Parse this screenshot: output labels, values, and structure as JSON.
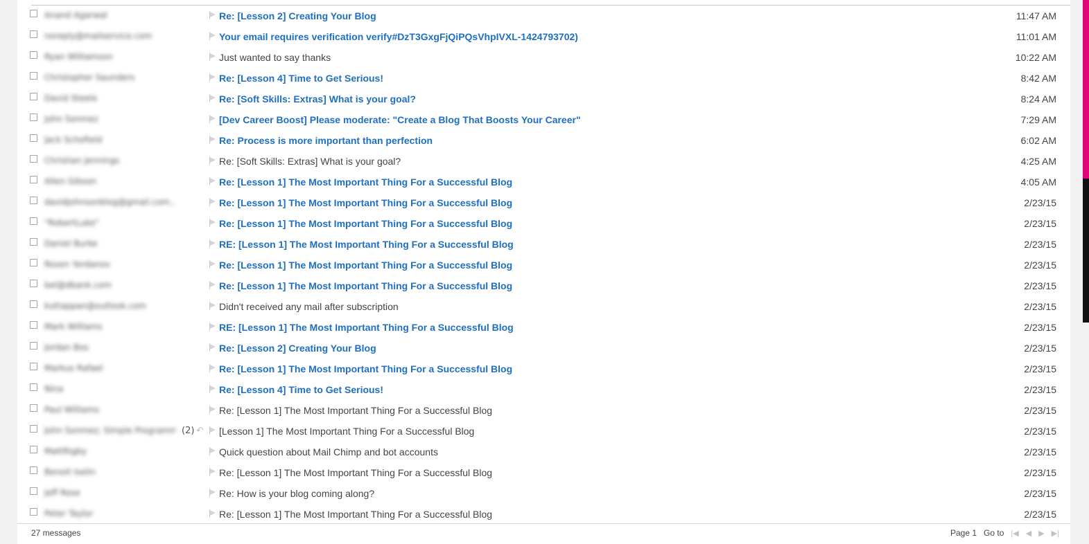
{
  "messages": [
    {
      "sender": "Anand Agarwal",
      "count": "",
      "subject": "Re: [Lesson 2] Creating Your Blog",
      "time": "11:47 AM",
      "unread": true
    },
    {
      "sender": "noreply@mailservice.com",
      "count": "",
      "subject": "Your email requires verification verify#DzT3GxgFjQiPQsVhpIVXL-1424793702)",
      "time": "11:01 AM",
      "unread": true
    },
    {
      "sender": "Ryan Williamson",
      "count": "",
      "subject": "Just wanted to say thanks",
      "time": "10:22 AM",
      "unread": false
    },
    {
      "sender": "Christopher Saunders",
      "count": "",
      "subject": "Re: [Lesson 4] Time to Get Serious!",
      "time": "8:42 AM",
      "unread": true
    },
    {
      "sender": "David Steele",
      "count": "",
      "subject": "Re: [Soft Skills: Extras] What is your goal?",
      "time": "8:24 AM",
      "unread": true
    },
    {
      "sender": "John Sonmez",
      "count": "",
      "subject": "[Dev Career Boost] Please moderate: \"Create a Blog That Boosts Your Career\"",
      "time": "7:29 AM",
      "unread": true
    },
    {
      "sender": "Jack Schofield",
      "count": "",
      "subject": "Re: Process is more important than perfection",
      "time": "6:02 AM",
      "unread": true
    },
    {
      "sender": "Christian Jennings",
      "count": "",
      "subject": "Re: [Soft Skills: Extras] What is your goal?",
      "time": "4:25 AM",
      "unread": false
    },
    {
      "sender": "Allen Gibson",
      "count": "",
      "subject": "Re: [Lesson 1] The Most Important Thing For a Successful Blog",
      "time": "4:05 AM",
      "unread": true
    },
    {
      "sender": "davidjohnsonblog@gmail.com...",
      "count": "",
      "subject": "Re: [Lesson 1] The Most Important Thing For a Successful Blog",
      "time": "2/23/15",
      "unread": true
    },
    {
      "sender": "\"RobertLuke\"",
      "count": "",
      "subject": "Re: [Lesson 1] The Most Important Thing For a Successful Blog",
      "time": "2/23/15",
      "unread": true
    },
    {
      "sender": "Daniel Burke",
      "count": "",
      "subject": "RE: [Lesson 1] The Most Important Thing For a Successful Blog",
      "time": "2/23/15",
      "unread": true
    },
    {
      "sender": "Rosen Yordanov",
      "count": "",
      "subject": "Re: [Lesson 1] The Most Important Thing For a Successful Blog",
      "time": "2/23/15",
      "unread": true
    },
    {
      "sender": "bel@dbank.com",
      "count": "",
      "subject": "Re: [Lesson 1] The Most Important Thing For a Successful Blog",
      "time": "2/23/15",
      "unread": true
    },
    {
      "sender": "kuttappan@outlook.com",
      "count": "",
      "subject": "Didn't received any mail after subscription",
      "time": "2/23/15",
      "unread": false
    },
    {
      "sender": "Mark Williams",
      "count": "",
      "subject": "RE: [Lesson 1] The Most Important Thing For a Successful Blog",
      "time": "2/23/15",
      "unread": true
    },
    {
      "sender": "Jordan Bos",
      "count": "",
      "subject": "Re: [Lesson 2] Creating Your Blog",
      "time": "2/23/15",
      "unread": true
    },
    {
      "sender": "Markus Rafael",
      "count": "",
      "subject": "Re: [Lesson 1] The Most Important Thing For a Successful Blog",
      "time": "2/23/15",
      "unread": true
    },
    {
      "sender": "Nina",
      "count": "",
      "subject": "Re: [Lesson 4] Time to Get Serious!",
      "time": "2/23/15",
      "unread": true
    },
    {
      "sender": "Paul Williams",
      "count": "",
      "subject": "Re: [Lesson 1] The Most Important Thing For a Successful Blog",
      "time": "2/23/15",
      "unread": false
    },
    {
      "sender": "John Sonmez; Simple Programmer...",
      "count": "(2)",
      "subject": "[Lesson 1] The Most Important Thing For a Successful Blog",
      "time": "2/23/15",
      "unread": false
    },
    {
      "sender": "MattRigby",
      "count": "",
      "subject": "Quick question about Mail Chimp and bot accounts",
      "time": "2/23/15",
      "unread": false
    },
    {
      "sender": "Benoit Iselin",
      "count": "",
      "subject": "Re: [Lesson 1] The Most Important Thing For a Successful Blog",
      "time": "2/23/15",
      "unread": false
    },
    {
      "sender": "Jeff Rose",
      "count": "",
      "subject": "Re: How is your blog coming along?",
      "time": "2/23/15",
      "unread": false
    },
    {
      "sender": "Peter Taylor",
      "count": "",
      "subject": "Re: [Lesson 1] The Most Important Thing For a Successful Blog",
      "time": "2/23/15",
      "unread": false
    }
  ],
  "footer": {
    "message_count": "27 messages",
    "page_label": "Page 1",
    "goto_label": "Go to"
  },
  "icons": {
    "flag": "flag-icon",
    "reply": "reply-icon",
    "first_page": "first-page-icon",
    "prev_page": "prev-page-icon",
    "next_page": "next-page-icon",
    "last_page": "last-page-icon"
  },
  "colors": {
    "unread_subject": "#1f6fc0",
    "read_subject": "#444444",
    "accent_bar": "#e3007a"
  }
}
